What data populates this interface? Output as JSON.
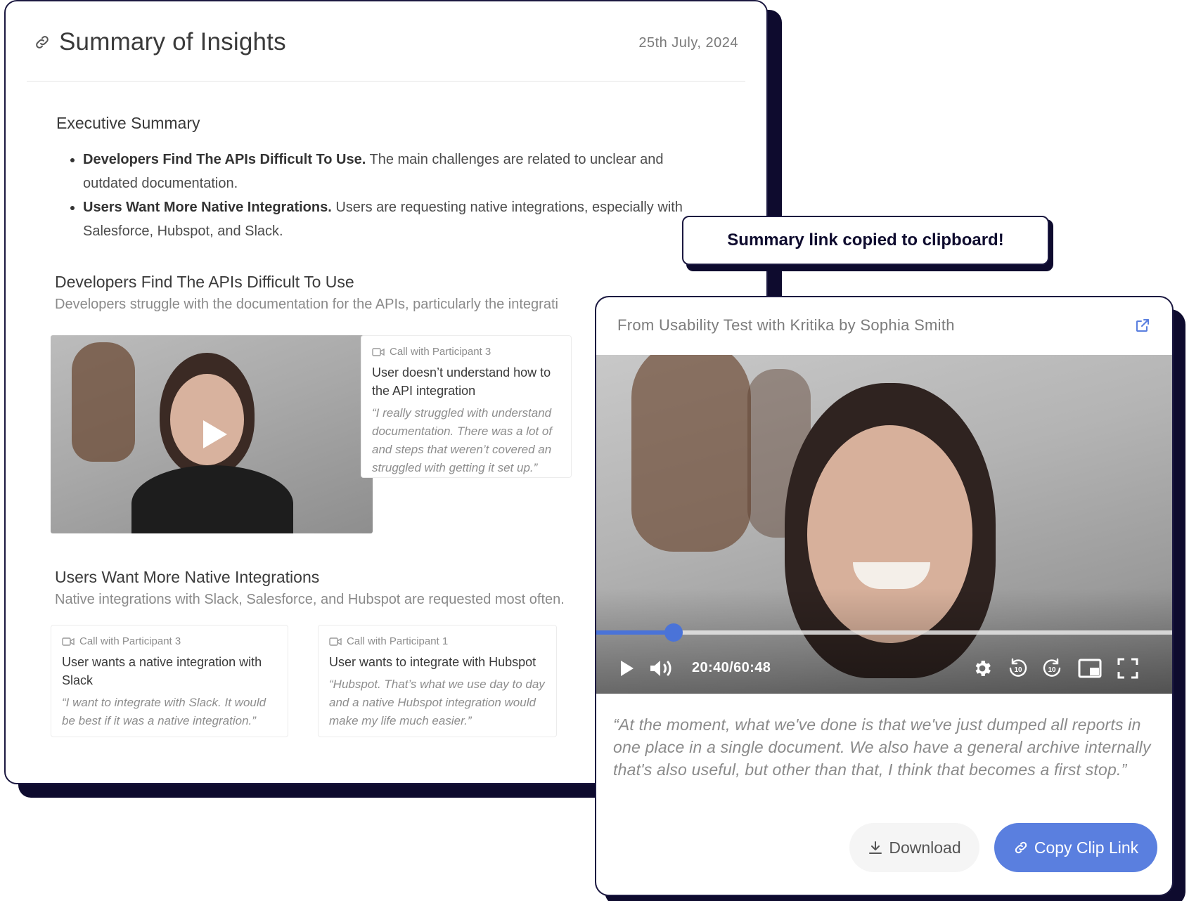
{
  "summary": {
    "title": "Summary of Insights",
    "date": "25th July, 2024",
    "executive_heading": "Executive Summary",
    "bullets": [
      {
        "bold": "Developers Find The APIs Difficult To Use.",
        "text": " The main challenges are related to unclear and outdated documentation."
      },
      {
        "bold": "Users Want More Native Integrations.",
        "text": " Users are requesting native integrations, especially with Salesforce, Hubspot, and Slack."
      }
    ],
    "sections": [
      {
        "title": "Developers Find The APIs Difficult To Use",
        "subtitle": "Developers struggle with the documentation for the APIs, particularly the integrati",
        "clips": [
          {
            "source": "Call with Participant 3",
            "title": "User doesn’t understand how to the API integration",
            "quote": "“I really struggled with understand documentation. There was a lot of and steps that weren’t covered an struggled with getting it set up.”"
          }
        ]
      },
      {
        "title": "Users Want More Native Integrations",
        "subtitle": "Native integrations with Slack, Salesforce, and Hubspot are requested most often.",
        "clips": [
          {
            "source": "Call with Participant 3",
            "title": "User wants a native integration with Slack",
            "quote": "“I want to integrate with Slack. It would be best if it was a native integration.”"
          },
          {
            "source": "Call with Participant 1",
            "title": "User wants to integrate with Hubspot",
            "quote": "“Hubspot. That’s what we use day to day and a native Hubspot integration would make my life much easier.”"
          }
        ]
      }
    ]
  },
  "toast": {
    "message": "Summary link copied to clipboard!"
  },
  "player": {
    "source": "From Usability Test with Kritika by Sophia Smith",
    "time": "20:40/60:48",
    "progress": 0.134,
    "quote": "“At the moment, what we've done is that we've just dumped all reports in one place in a single document. We also have a general archive internally that's also useful, but other than that, I think that becomes a first stop.”",
    "download_label": "Download",
    "copy_label": "Copy Clip Link",
    "accent": "#5a7fdf"
  },
  "icons": {
    "link": "link-icon",
    "video": "video-camera-icon",
    "play": "play-icon",
    "volume": "volume-icon",
    "settings": "gear-icon",
    "rewind": "rewind-10-icon",
    "forward": "forward-10-icon",
    "pip": "picture-in-picture-icon",
    "fullscreen": "fullscreen-icon",
    "download": "download-icon",
    "external": "external-link-icon"
  }
}
